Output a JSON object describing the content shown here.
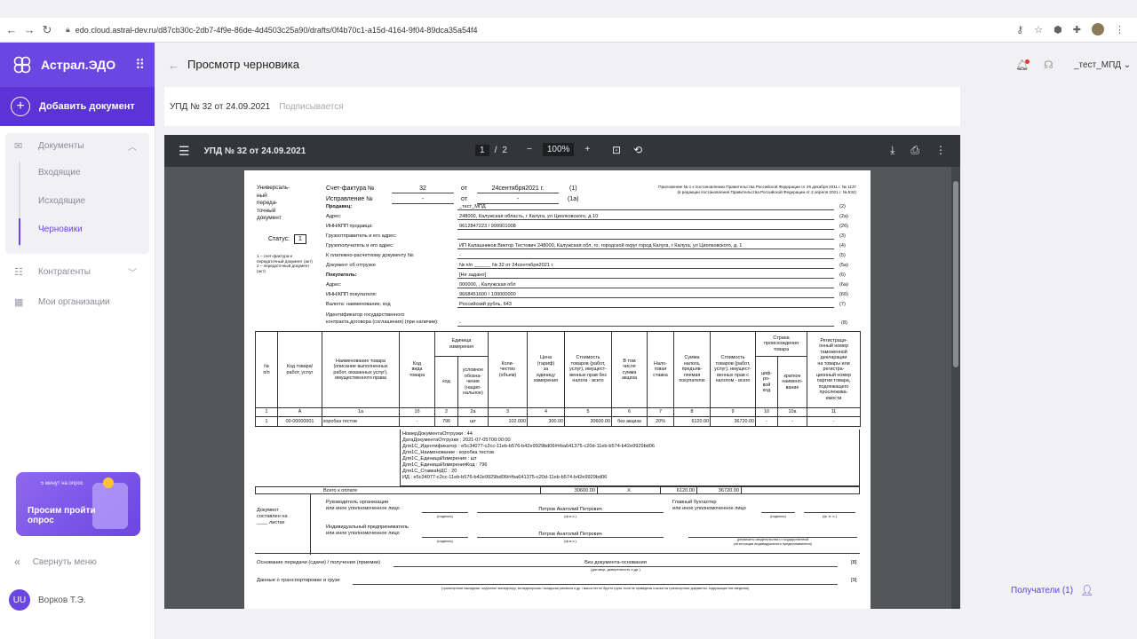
{
  "browser": {
    "url": "edo.cloud.astral-dev.ru/d87cb30c-2db7-4f9e-86de-4d4503c25a90/drafts/0f4b70c1-a15d-4164-9f04-89dca35a54f4"
  },
  "app": {
    "name": "Астрал.ЭДО",
    "add_document": "Добавить документ"
  },
  "sidebar": {
    "documents": "Документы",
    "incoming": "Входящие",
    "outgoing": "Исходящие",
    "drafts": "Черновики",
    "contractors": "Контрагенты",
    "my_orgs": "Мои организации",
    "collapse": "Свернуть меню",
    "user_initials": "UU",
    "user_name": "Ворков Т.Э."
  },
  "survey": {
    "small": "5 минут на опрос",
    "big": "Просим пройти опрос"
  },
  "header": {
    "title": "Просмотр черновика",
    "org": "_тест_МПД"
  },
  "doc": {
    "title": "УПД № 32 от 24.09.2021",
    "status": "Подписывается"
  },
  "viewer": {
    "name": "УПД № 32 от 24.09.2021",
    "page": "1",
    "pages": "2",
    "zoom": "100%"
  },
  "upd": {
    "kind": "Универсаль-\nный\nпереда-\nточный\nдокумент",
    "status_label": "Статус:",
    "status_value": "1",
    "status_note": "1 – счет-фактура и передаточный документ (акт)\n2 – передаточный документ (акт)",
    "appendix1": "Приложение № 1 к постановлению Правительства Российской Федерации от 26 декабря 2011 г. № 1137",
    "appendix2": "(в редакции постановления Правительства Российской Федерации от 2 апреля 2021 г. № 534)",
    "invoice_label": "Счет-фактура №",
    "invoice_no": "32",
    "from": "от",
    "invoice_date": "24сентября2021 г.",
    "code1": "(1)",
    "correction_label": "Исправление №",
    "correction_no": "-",
    "correction_date": "-",
    "code1a": "(1а)",
    "rows": [
      {
        "label": "Продавец:",
        "value": "_тест_МПД",
        "code": "(2)",
        "bold": true
      },
      {
        "label": "Адрес:",
        "value": "248000, Калужская область, г Калуга, ул Циолковского, д 10",
        "code": "(2а)"
      },
      {
        "label": "ИНН/КПП продавца:",
        "value": "9612847223 / 999901008",
        "code": "(2б)"
      },
      {
        "label": "Грузоотправитель и его адрес:",
        "value": "",
        "code": "(3)"
      },
      {
        "label": "Грузополучатель и его адрес:",
        "value": "ИП Калашников Виктор Тестович 248000, Калужская обл, го. городской округ город Калуга, г Калуга, ул Циолковского, д. 1",
        "code": "(4)"
      },
      {
        "label": "К платежно-расчетному документу №:",
        "value": "-",
        "code": "(5)"
      },
      {
        "label": "Документ об отгрузке",
        "value": "№ п/п ______ № 32 от 24сентября2021 г.",
        "code": "(5а)"
      },
      {
        "label": "Покупатель:",
        "value": "[Не задано]",
        "code": "(6)",
        "bold": true
      },
      {
        "label": "Адрес:",
        "value": "000000, , Калужская обл",
        "code": "(6а)"
      },
      {
        "label": "ИНН/КПП покупателя:",
        "value": "9668451600 / 100000000",
        "code": "(6б)"
      },
      {
        "label": "Валюта: наименование, код",
        "value": "Российский рубль, 643",
        "code": "(7)"
      }
    ],
    "contract_label1": "Идентификатор государственного",
    "contract_label2": "контракта,договора (соглашения) (при наличии):",
    "contract_value": "-",
    "contract_code": "(8)",
    "table_headers": {
      "num": "№\nп/п",
      "code": "Код товара/\nработ, услуг",
      "name": "Наименование товара\n(описание выполненных\nработ, оказанных услуг),\nимущественного права",
      "type": "Код\nвида\nтовара",
      "unit": "Единица\nизмерения",
      "unit_code": "код",
      "unit_name": "условное\nобозна-\nчение\n(нацио-\nнальное)",
      "qty": "Коли-\nчество\n(объем)",
      "price": "Цена\n(тариф)\nза\nединицу\nизмерения",
      "cost": "Стоимость\nтоваров (работ,\nуслуг), имущест-\nвенных прав без\nналога - всего",
      "excise": "В том\nчисле\nсумма\nакциза",
      "rate": "Нало-\nговая\nставка",
      "tax": "Сумма\nналога,\nпредъяв-\nляемая\nпокупателю",
      "total": "Стоимость\nтоваров (работ,\nуслуг), имущест-\nвенных прав с\nналогом - всего",
      "country": "Страна\nпроисхождения\nтовара",
      "country_code": "циф-\nро-\nвой\nкод",
      "country_name": "краткое\nнаимено-\nвание",
      "customs": "Регистраци-\nонный номер\nтаможенной\nдекларации\nна товары или\nрегистра-\nционный номер\nпартии товара,\nподлежащего\nпрослежива-\nемости"
    },
    "col_numbers": [
      "1",
      "А",
      "1а",
      "1б",
      "2",
      "2а",
      "3",
      "4",
      "5",
      "6",
      "7",
      "8",
      "9",
      "10",
      "10а",
      "11"
    ],
    "item": [
      "1",
      "00-00000001",
      "коробка тестов",
      "-",
      "796",
      "шт",
      "102.000",
      "300.00",
      "30600.00",
      "без акциза",
      "20%",
      "6120.00",
      "36720.00",
      "-",
      "-",
      "-"
    ],
    "extra_lines": [
      "НомерДокументаОтгрузки : 44",
      "ДатаДокументаОтгрузки : 2021-07-05T00:00:00",
      "Для1С_Идентификатор : e5c34077-c2cc-11eb-b576-b42e9929bd06##ba641375-c20d-11eb-b574-b42e9929bd06",
      "Для1С_Наименование : коробка тестов",
      "Для1С_ЕдиницаИзмерения : шт",
      "Для1С_ЕдиницаИзмеренияКод : 796",
      "Для1С_СтавкаНДС : 20",
      "ИД : e5c34077-c2cc-11eb-b576-b42e9929bd06##ba641375-c20d-11eb-b574-b42e9929bd06"
    ],
    "total_label": "Всего к оплате",
    "total_cost": "30600.00",
    "total_excise": "X",
    "total_tax": "6120.00",
    "total_sum": "36720.00",
    "doc_made_label": "Документ\nсоставлен на\n____ листах",
    "head_label": "Руководитель организации\nили иное уполномоченное лицо",
    "head_name": "Петров Анатолий Петрович",
    "chief_label": "Главный бухгалтер\nили иное уполномоченное лицо",
    "ip_label": "Индивидуальный предприниматель\nили иное уполномоченное лицо",
    "ip_name": "Петров Анатолий Петрович",
    "sign": "(подпись)",
    "fio": "(ф.и.о.)",
    "fio2": "(ф. и. о.)",
    "ip_req": "(реквизиты свидетельства о государственной\nрегистрации индивидуального предпринимателя)",
    "basis_label": "Основание передачи (сдачи) / получения (приемки)",
    "basis_value": "Без документа-основания",
    "basis_code": "[8]",
    "basis_sub": "(договор; доверенность и др.)",
    "transport_label": "Данные о транспортировке и грузе",
    "transport_code": "[9]",
    "transport_sub": "(транспортная накладная, поручение экспедитору, экспедиторская / складская расписка и др. / масса нетто/ брутто груза, если не приведены ссылки на транспортные документы, содержащие эти сведения)"
  },
  "recipients": "Получатели (1)"
}
